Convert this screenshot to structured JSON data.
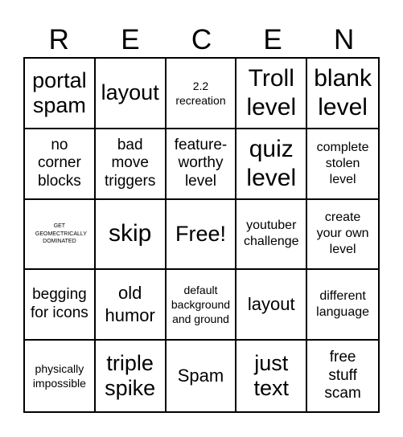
{
  "title_letters": [
    "R",
    "E",
    "C",
    "E",
    "N"
  ],
  "cells": [
    [
      "portal spam",
      "layout",
      "2.2 recreation",
      "Troll level",
      "blank level"
    ],
    [
      "no corner blocks",
      "bad move triggers",
      "feature-worthy level",
      "quiz level",
      "complete stolen level"
    ],
    [
      "GET GEOMECTRICALLY DOMINATED",
      "skip",
      "Free!",
      "youtuber challenge",
      "create your own level"
    ],
    [
      "begging for icons",
      "old humor",
      "default background and ground",
      "layout",
      "different language"
    ],
    [
      "physically impossible",
      "triple spike",
      "Spam",
      "just text",
      "free stuff scam"
    ]
  ]
}
